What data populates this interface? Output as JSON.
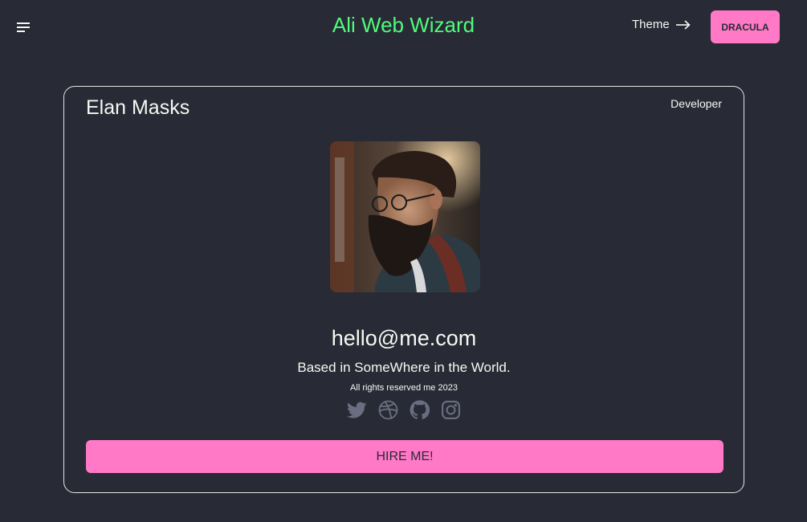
{
  "navbar": {
    "menu_icon": "hamburger-menu-icon",
    "brand": "Ali Web Wizard",
    "theme_label": "Theme",
    "theme_arrow_icon": "arrow-right-icon",
    "theme_button": "DRACULA"
  },
  "profile": {
    "name": "Elan Masks",
    "role": "Developer",
    "avatar_icon": "profile-photo",
    "email": "hello@me.com",
    "location": "Based in SomeWhere in the World.",
    "rights": "All rights reserved me 2023",
    "socials": [
      "twitter-icon",
      "dribbble-icon",
      "github-icon",
      "instagram-icon"
    ],
    "hire_button": "HIRE ME!"
  },
  "colors": {
    "background": "#282a36",
    "accent_green": "#50fa7b",
    "accent_pink": "#ff79c6",
    "text": "#f8f8f2",
    "icon_muted": "#6a6e80"
  }
}
